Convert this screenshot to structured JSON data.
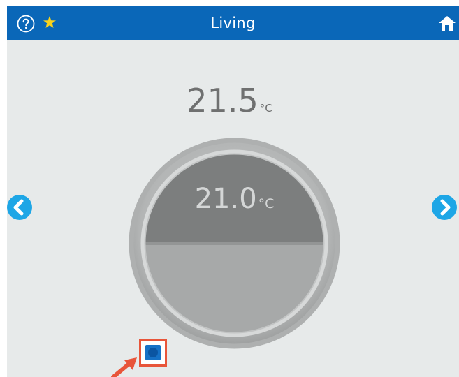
{
  "header": {
    "title": "Living",
    "icons": [
      "help-icon",
      "star-icon",
      "home-icon"
    ]
  },
  "thermostat": {
    "current_temp": "21.5",
    "current_unit": "°C",
    "setpoint": "21.0",
    "setpoint_unit": "°C"
  },
  "colors": {
    "header_bg": "#0a67b8",
    "nav_button": "#1ea6e6",
    "highlight": "#e8553a",
    "mode_button": "#1671c6"
  }
}
